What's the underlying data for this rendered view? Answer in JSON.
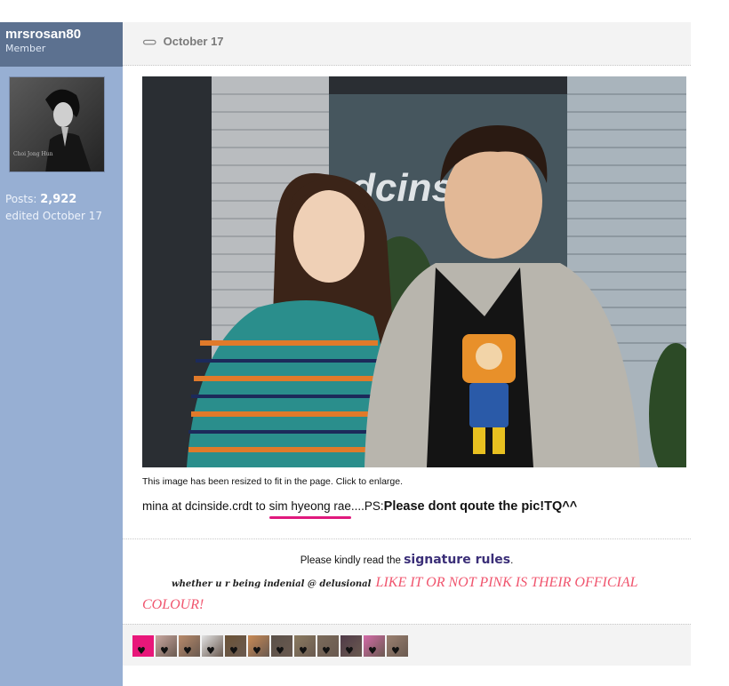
{
  "user": {
    "name": "mrsrosan80",
    "role": "Member",
    "posts_label": "Posts: ",
    "posts_count": "2,922",
    "edited": "edited October 17",
    "avatar_caption": "Choi Jong Hun"
  },
  "post": {
    "date": "October 17",
    "resize_note": "This image has been resized to fit in the page. Click to enlarge.",
    "photo_sign": "dcins",
    "caption": {
      "pre": "mina at dcinside.crdt to ",
      "name": "sim hyeong rae",
      "mid": "....PS:",
      "bold": "Please dont qoute the pic!TQ^^"
    }
  },
  "signature": {
    "line1_pre": "Please kindly read the ",
    "line1_link": "signature rules",
    "line1_post": ".",
    "small_text": "whether u r being indenial @ delusional",
    "big_text": "LIKE IT OR NOT PINK IS THEIR OFFICIAL COLOUR!"
  },
  "icons": [
    "#e8177a",
    "#c9a7a0",
    "#b88a6a",
    "#e2e2e2",
    "#6b5236",
    "#c98a55",
    "#5a5048",
    "#8a7a60",
    "#7a6a5a",
    "#503a48",
    "#d46aa8",
    "#9a8070"
  ],
  "colors": {
    "sidebar": "#97afd3",
    "sidebar_head": "#5c7190",
    "pink": "#e0197d",
    "sig_red": "#f0556e"
  }
}
